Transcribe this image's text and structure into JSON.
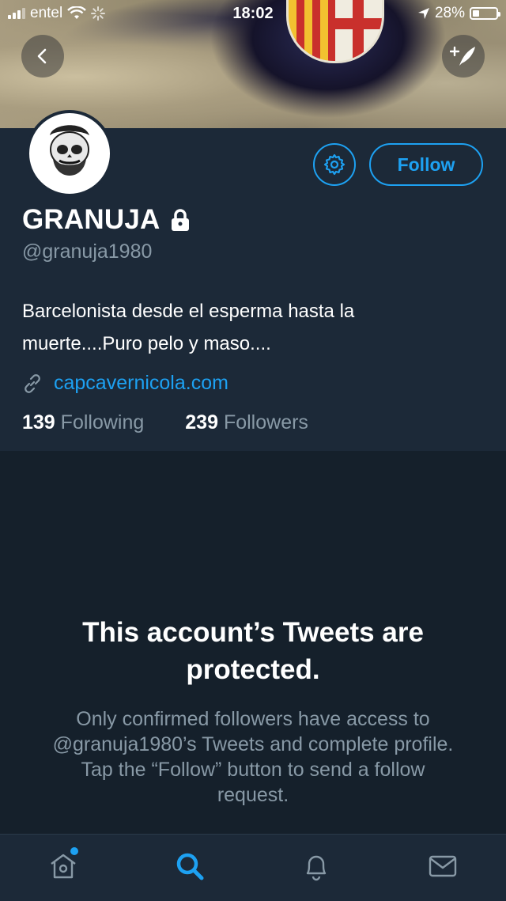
{
  "status_bar": {
    "carrier": "entel",
    "time": "18:02",
    "battery": "28%"
  },
  "profile": {
    "display_name": "GRANUJA",
    "handle": "@granuja1980",
    "bio": "Barcelonista desde el esperma hasta la muerte....Puro pelo y maso....",
    "website": "capcavernicola.com",
    "following_count": "139",
    "following_label": "Following",
    "followers_count": "239",
    "followers_label": "Followers",
    "follow_button": "Follow"
  },
  "protected_notice": {
    "title": "This account’s Tweets are protected.",
    "body": "Only confirmed followers have access to @granuja1980’s Tweets and complete profile. Tap the “Follow” button to send a follow request."
  },
  "icons": {
    "back": "chevron-left-icon",
    "compose": "compose-tweet-icon",
    "settings": "gear-icon",
    "lock": "lock-icon",
    "link": "link-icon",
    "tabs": [
      "home-icon",
      "search-icon",
      "bell-icon",
      "mail-icon"
    ]
  },
  "colors": {
    "accent": "#1da1f2",
    "background": "#15202b",
    "panel": "#1c2938",
    "secondary_text": "#8899a6"
  }
}
